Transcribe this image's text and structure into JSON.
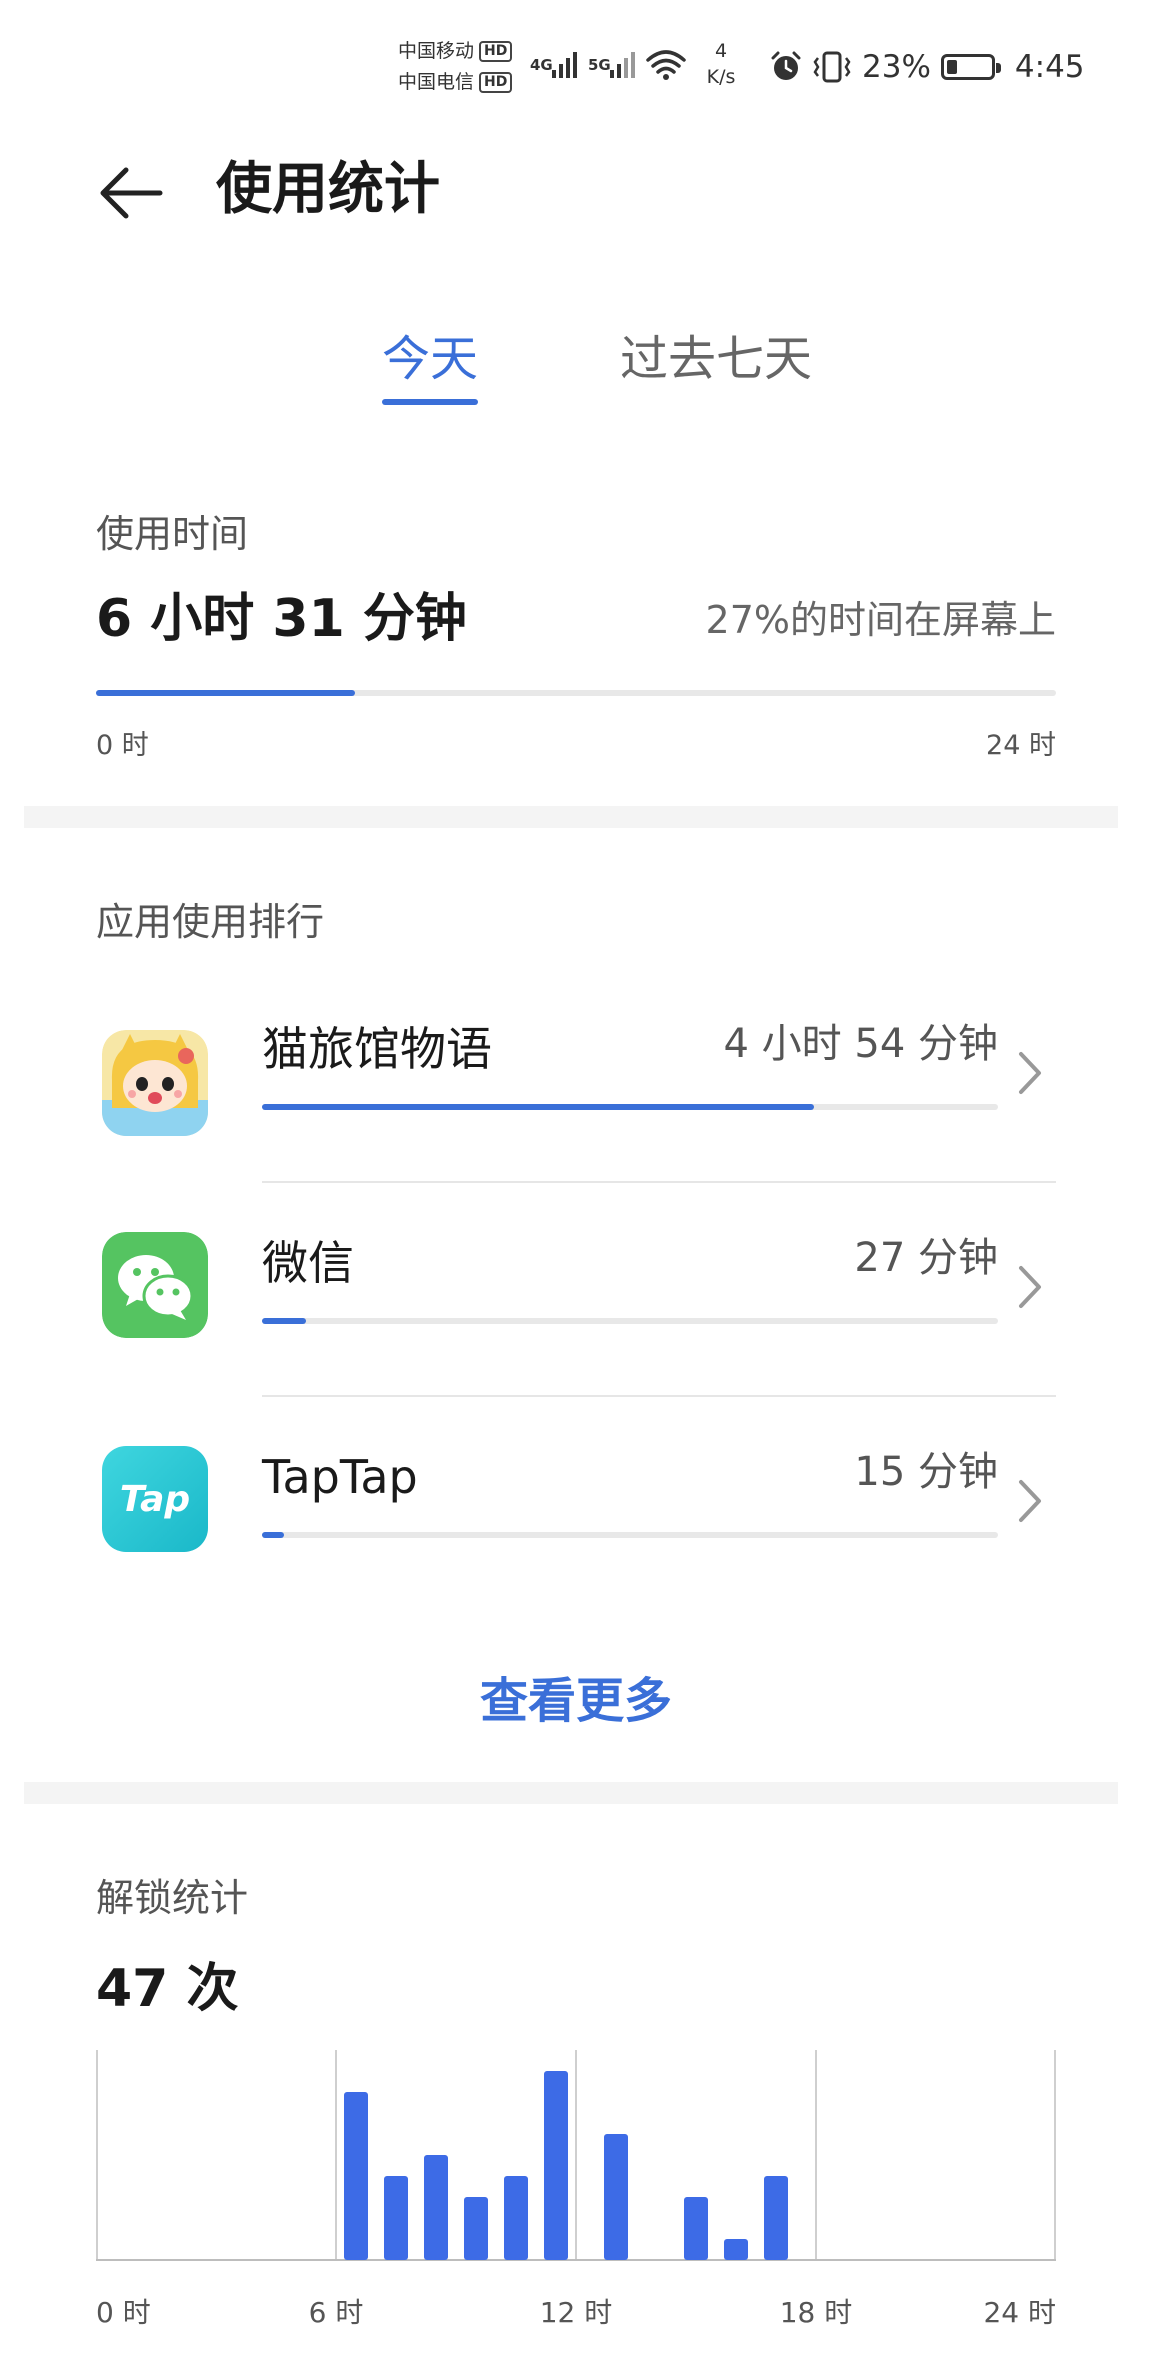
{
  "status_bar": {
    "carrier1": "中国移动",
    "carrier2": "中国电信",
    "hd": "HD",
    "net1": "4G",
    "net2": "5G",
    "speed_value": "4",
    "speed_unit": "K/s",
    "battery_text": "23%",
    "battery_level": 0.23,
    "time": "4:45"
  },
  "header": {
    "title": "使用统计"
  },
  "tabs": [
    {
      "label": "今天",
      "active": true
    },
    {
      "label": "过去七天",
      "active": false
    }
  ],
  "usage": {
    "label": "使用时间",
    "total": "6 小时 31 分钟",
    "screen_share": "27%的时间在屏幕上",
    "progress": 0.27,
    "axis_start": "0 时",
    "axis_end": "24 时"
  },
  "ranking": {
    "label": "应用使用排行",
    "apps": [
      {
        "name": "猫旅馆物语",
        "time": "4 小时 54 分钟",
        "share": 0.75,
        "icon": "cat-hotel-game-icon"
      },
      {
        "name": "微信",
        "time": "27 分钟",
        "share": 0.06,
        "icon": "wechat-icon"
      },
      {
        "name": "TapTap",
        "time": "15 分钟",
        "share": 0.03,
        "icon": "taptap-icon",
        "icon_text": "Tap"
      }
    ],
    "more": "查看更多"
  },
  "unlocks": {
    "label": "解锁统计",
    "total": "47 次"
  },
  "chart_data": {
    "type": "bar",
    "title": "",
    "xlabel": "",
    "ylabel": "",
    "x_ticks": [
      "0 时",
      "6 时",
      "12 时",
      "18 时",
      "24 时"
    ],
    "xlim": [
      0,
      24
    ],
    "ylim": [
      0,
      10
    ],
    "x": [
      6.5,
      7.5,
      8.5,
      9.5,
      10.5,
      11.5,
      13,
      15,
      16,
      17
    ],
    "values": [
      8,
      4,
      5,
      3,
      4,
      9,
      6,
      3,
      1,
      4
    ],
    "grid": true,
    "color": "#3d6be6"
  },
  "colors": {
    "accent": "#3a6fd8",
    "bar": "#3d6be6"
  }
}
